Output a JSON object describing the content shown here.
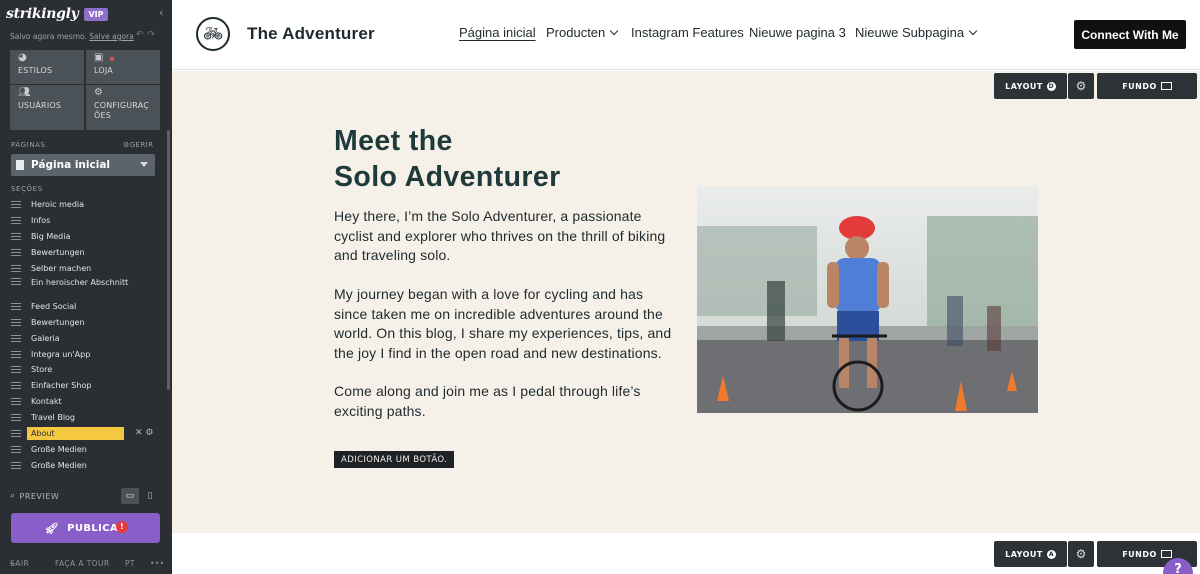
{
  "sidebar": {
    "logo": "strikingly",
    "vip_badge": "VIP",
    "save_status": "Salvo agora mesmo.",
    "save_link": "Salve agora",
    "nav": [
      {
        "label": "ESTILOS",
        "icon": "palette-icon"
      },
      {
        "label": "LOJA",
        "icon": "bag-icon"
      },
      {
        "label": "USUÁRIOS",
        "icon": "users-icon"
      },
      {
        "label": "CONFIGURAÇ ÕES",
        "icon": "gear-icon"
      }
    ],
    "pages_label": "PÁGINAS",
    "manage_label": "GERIR",
    "current_page": "Página inicial",
    "sections_label": "SEÇÕES",
    "sections": [
      "Heroic media",
      "Infos",
      "Big Media",
      "Bewertungen",
      "Selber machen",
      "Ein heroischer Abschnitt",
      "Feed Social",
      "Bewertungen",
      "Galeria",
      "Integra un'App",
      "Store",
      "Einfacher Shop",
      "Kontakt",
      "Travel Blog",
      "About",
      "Große Medien",
      "Große Medien"
    ],
    "active_section": "About",
    "preview_label": "PREVIEW",
    "publish_label": "PUBLICAR",
    "publish_alert": "!",
    "footer": {
      "exit": "SAIR",
      "tour": "FAÇA A TOUR",
      "lang": "PT",
      "more": "•••"
    }
  },
  "header": {
    "site_name": "The Adventurer",
    "nav": [
      {
        "label": "Página inicial",
        "active": true,
        "dropdown": false
      },
      {
        "label": "Producten",
        "active": false,
        "dropdown": true
      },
      {
        "label": "Instagram Features",
        "active": false,
        "dropdown": false
      },
      {
        "label": "Nieuwe pagina 3",
        "active": false,
        "dropdown": false
      },
      {
        "label": "Nieuwe Subpagina",
        "active": false,
        "dropdown": true
      }
    ],
    "cta": "Connect With Me"
  },
  "section": {
    "tools": {
      "layout": "LAYOUT",
      "layout_badge_top": "D",
      "layout_badge_bottom": "A",
      "background": "FUNDO"
    },
    "heading_line1": "Meet the",
    "heading_line2": "Solo Adventurer",
    "paragraphs": [
      "Hey there, I’m the Solo Adventurer, a passionate cyclist and explorer who thrives on the thrill of biking and traveling solo.",
      "My journey began with a love for cycling and has since taken me on incredible adventures around the world. On this blog, I share my experiences, tips, and the joy I find in the open road and new destinations.",
      "Come along and join me as I pedal through life’s exciting paths."
    ],
    "add_button": "ADICIONAR UM BOTÃO.",
    "image_alt": "cyclist racing photo"
  },
  "help_label": "?",
  "colors": {
    "sidebar_bg": "#2b2f33",
    "accent": "#8a5ec9",
    "active_section": "#f5c842",
    "section_bg": "#f6f1e8",
    "heading": "#1e3a3b"
  }
}
